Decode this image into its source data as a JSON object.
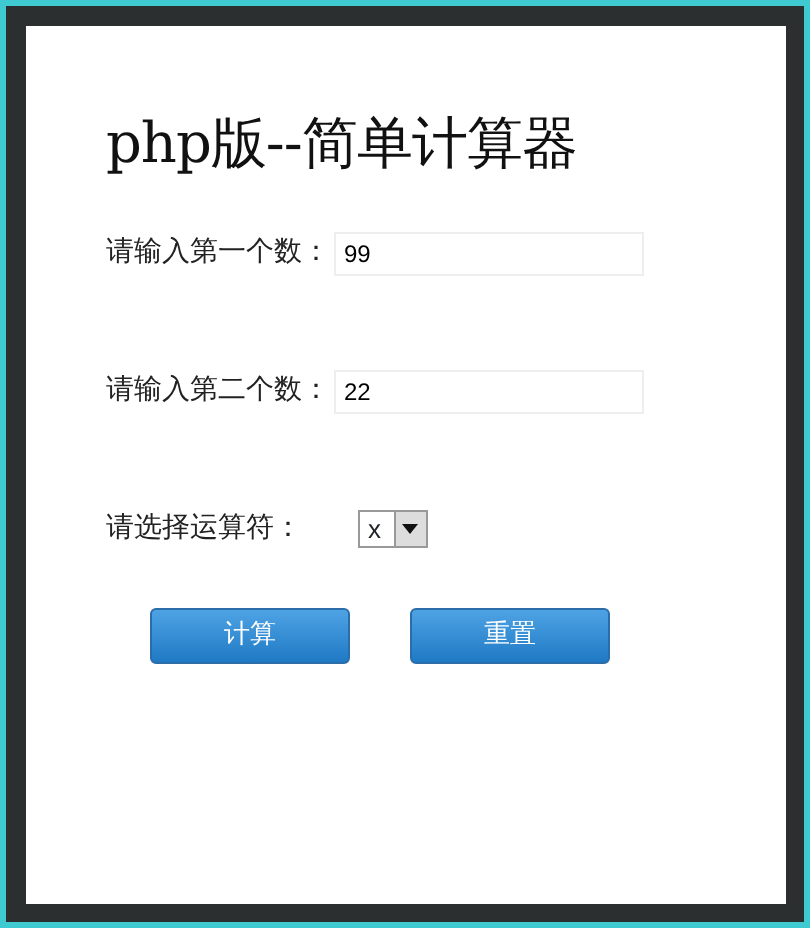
{
  "title": "php版--简单计算器",
  "fields": [
    {
      "label": "请输入第一个数：",
      "value": "99"
    },
    {
      "label": "请输入第二个数：",
      "value": "22"
    }
  ],
  "operator": {
    "label": "请选择运算符：",
    "value": "x"
  },
  "buttons": [
    "计算",
    "重置"
  ]
}
